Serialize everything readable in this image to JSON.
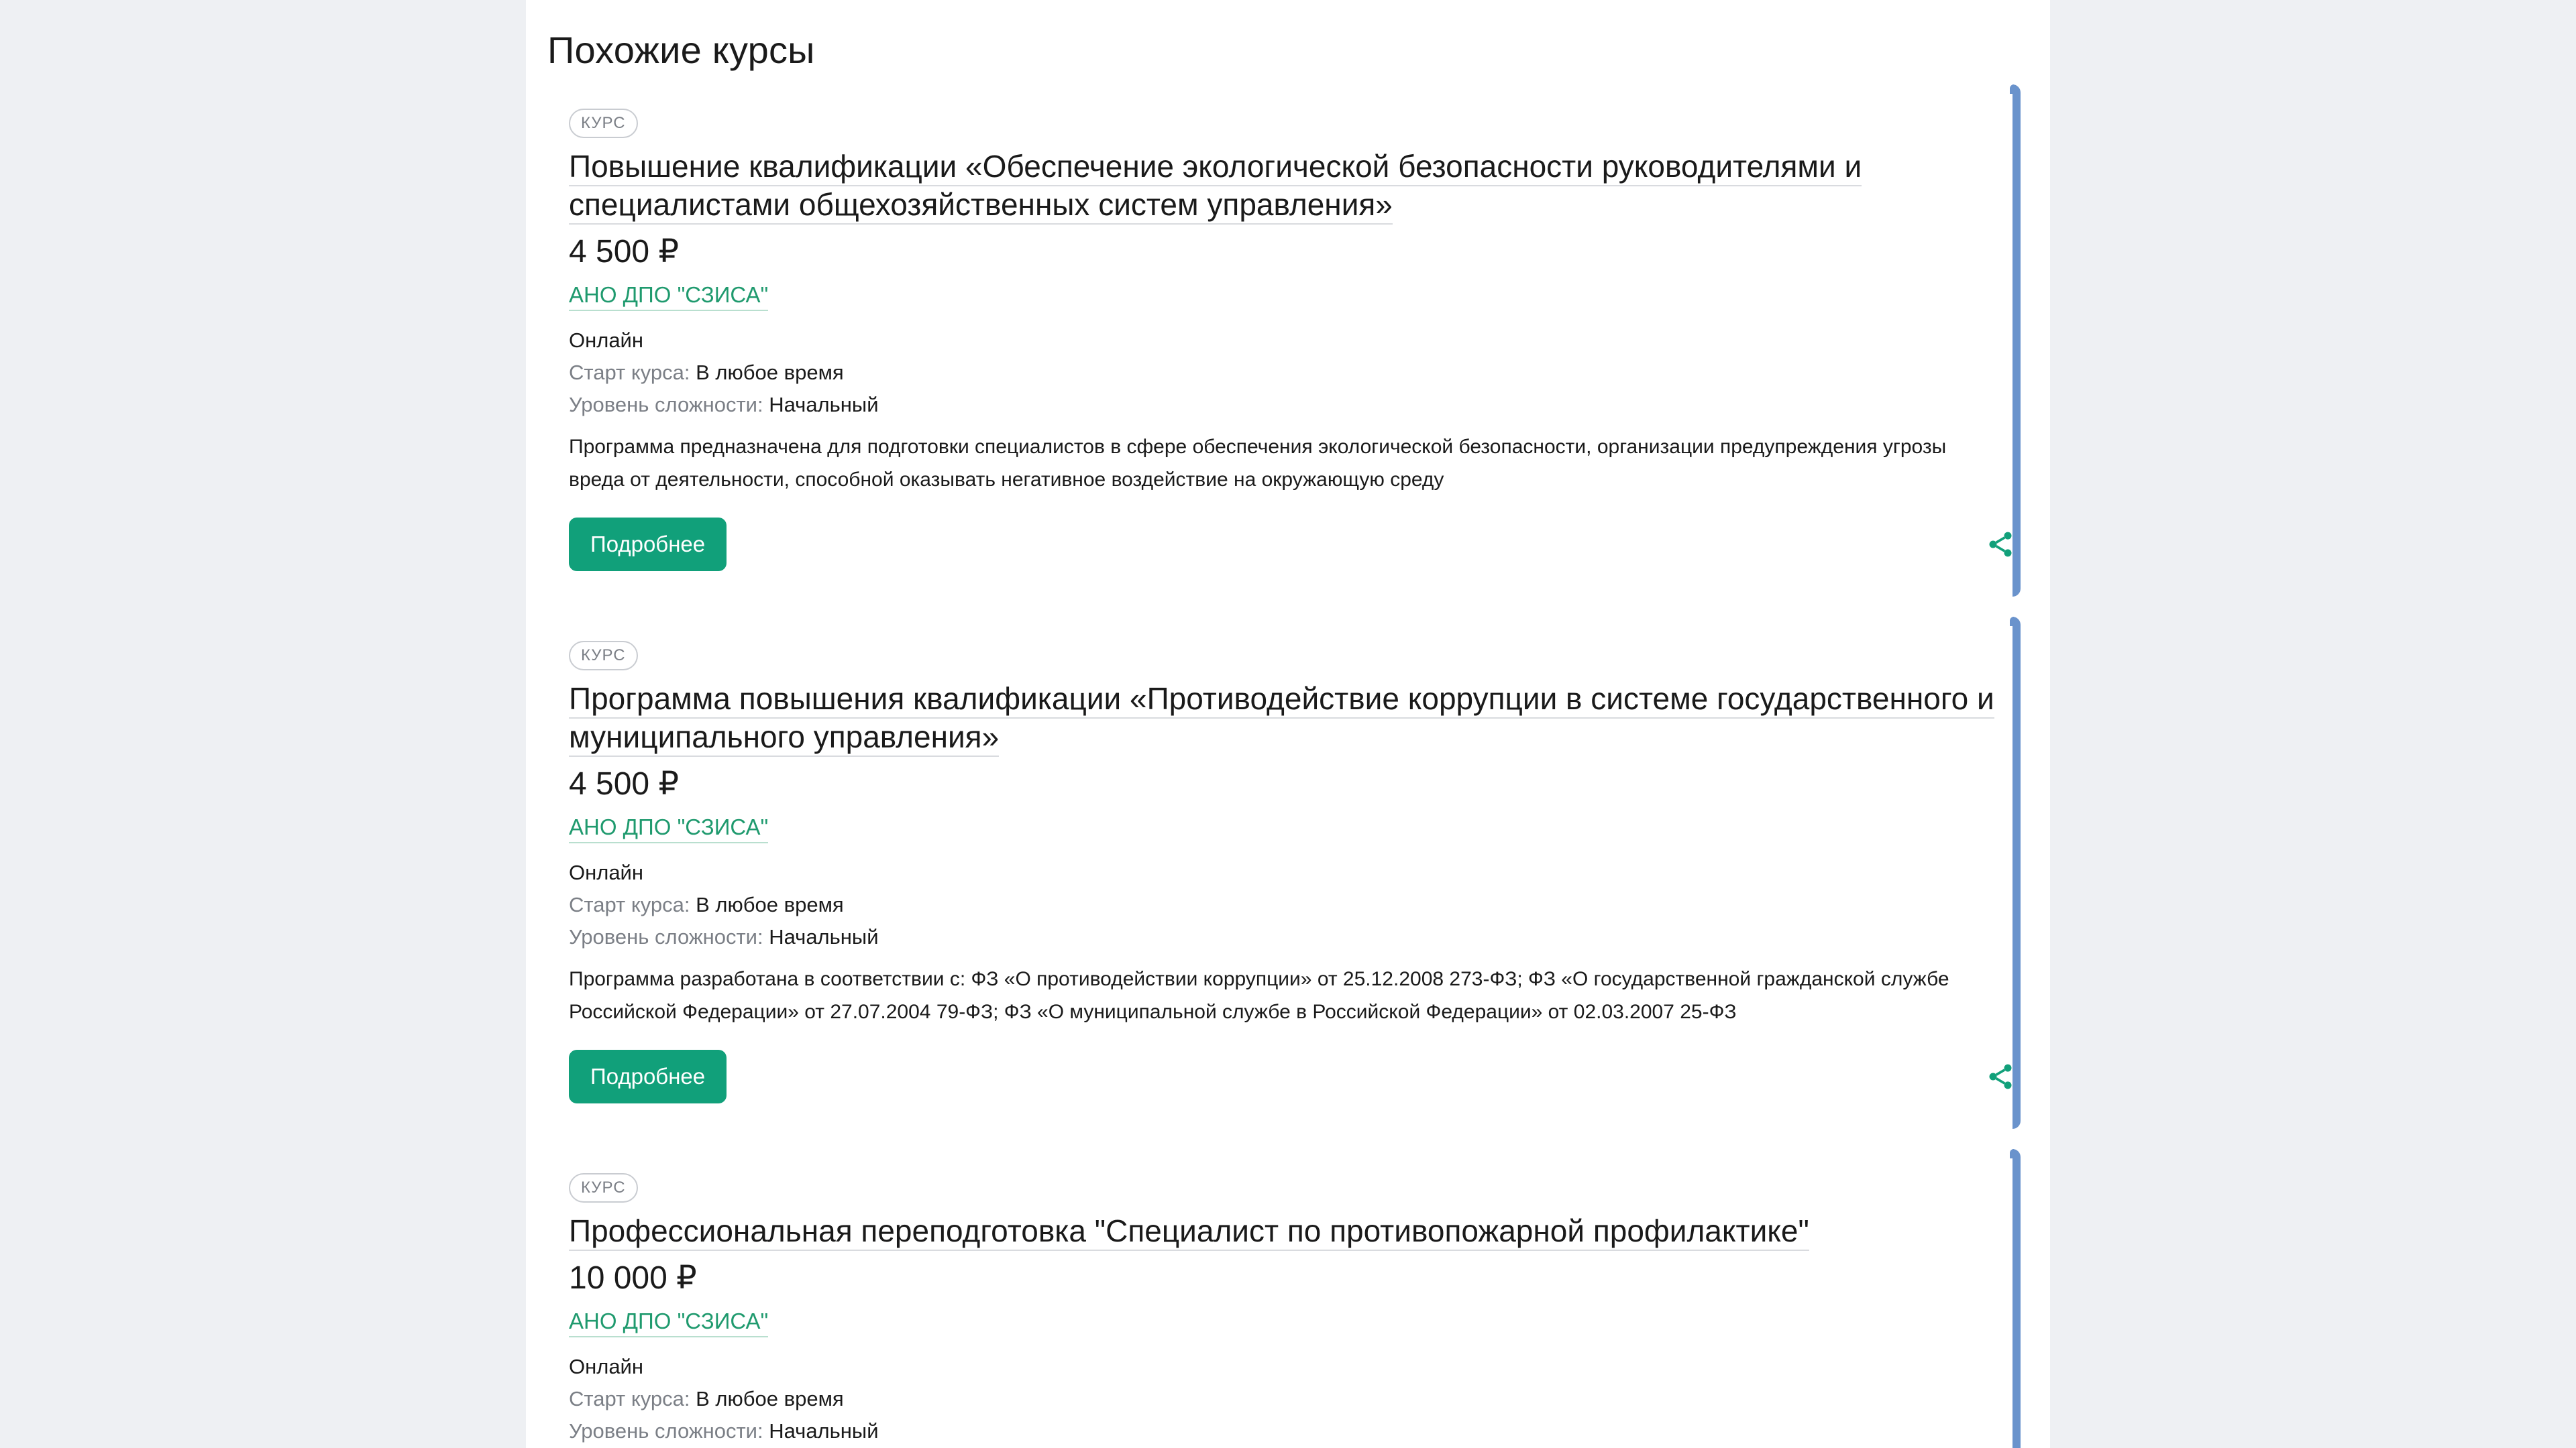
{
  "section": {
    "title": "Похожие курсы"
  },
  "courses": [
    {
      "badge": "КУРС",
      "title": "Повышение квалификации «Обеспечение экологической безопасности руководителями и специалистами общехозяйственных систем управления»",
      "price": "4 500 ₽",
      "provider": "АНО ДПО \"СЗИСА\"",
      "format": "Онлайн",
      "start_label": "Старт курса:",
      "start_value": "В любое время",
      "level_label": "Уровень сложности:",
      "level_value": "Начальный",
      "description": "Программа предназначена для подготовки специалистов в сфере обеспечения экологической безопасности, организации предупреждения угрозы вреда от деятельности, способной оказывать негативное воздействие на окружающую среду",
      "button_label": "Подробнее",
      "share_icon": "share-icon"
    },
    {
      "badge": "КУРС",
      "title": "Программа повышения квалификации «Противодействие коррупции в системе государственного и муниципального управления»",
      "price": "4 500 ₽",
      "provider": "АНО ДПО \"СЗИСА\"",
      "format": "Онлайн",
      "start_label": "Старт курса:",
      "start_value": "В любое время",
      "level_label": "Уровень сложности:",
      "level_value": "Начальный",
      "description": "Программа разработана в соответствии с: ФЗ «О противодействии коррупции» от 25.12.2008 273-ФЗ; ФЗ «О государственной гражданской службе Российской Федерации» от 27.07.2004 79-ФЗ; ФЗ «О муниципальной службе в Российской Федерации» от 02.03.2007 25-ФЗ",
      "button_label": "Подробнее",
      "share_icon": "share-icon"
    },
    {
      "badge": "КУРС",
      "title": "Профессиональная переподготовка \"Специалист по противопожарной профилактике\"",
      "price": "10 000 ₽",
      "provider": "АНО ДПО \"СЗИСА\"",
      "format": "Онлайн",
      "start_label": "Старт курса:",
      "start_value": "В любое время",
      "level_label": "Уровень сложности:",
      "level_value": "Начальный"
    }
  ],
  "colors": {
    "accent_green": "#11a07a",
    "provider_green": "#1f9a6e",
    "card_edge_blue": "#6a93cc",
    "page_background": "#eef0f3"
  }
}
